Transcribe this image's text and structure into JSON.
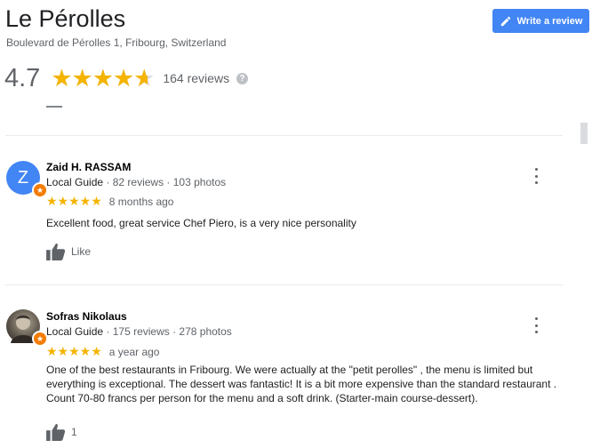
{
  "place": {
    "name": "Le Pérolles",
    "address": "Boulevard de Pérolles 1, Fribourg, Switzerland",
    "rating": "4.7",
    "rating_value": 4.7,
    "reviews_count": "164 reviews",
    "help_glyph": "?"
  },
  "write_review": {
    "label": "Write a review",
    "icon": "pencil-icon"
  },
  "colors": {
    "accent": "#4285f4",
    "star": "#f4b400",
    "badge": "#f57c00"
  },
  "reviews": [
    {
      "initial": "Z",
      "author": "Zaid H. RASSAM",
      "guide": "Local Guide",
      "reviews": "82 reviews",
      "photos": "103 photos",
      "stars": "★★★★★",
      "rating": 5,
      "time": "8 months ago",
      "text": "Excellent food, great service Chef Piero, is a very nice personality",
      "like_label": "Like"
    },
    {
      "author": "Sofras Nikolaus",
      "guide": "Local Guide",
      "reviews": "175 reviews",
      "photos": "278 photos",
      "stars": "★★★★★",
      "rating": 5,
      "time": "a year ago",
      "text": "One of the best restaurants in Fribourg. We were actually at the \"petit perolles\" , the menu is limited but everything is exceptional. The dessert was fantastic! It is a bit more expensive than the standard restaurant . Count 70-80 francs per person for the menu and a soft drink. (Starter-main course-dessert).",
      "like_label": "1"
    }
  ],
  "separator": " · "
}
